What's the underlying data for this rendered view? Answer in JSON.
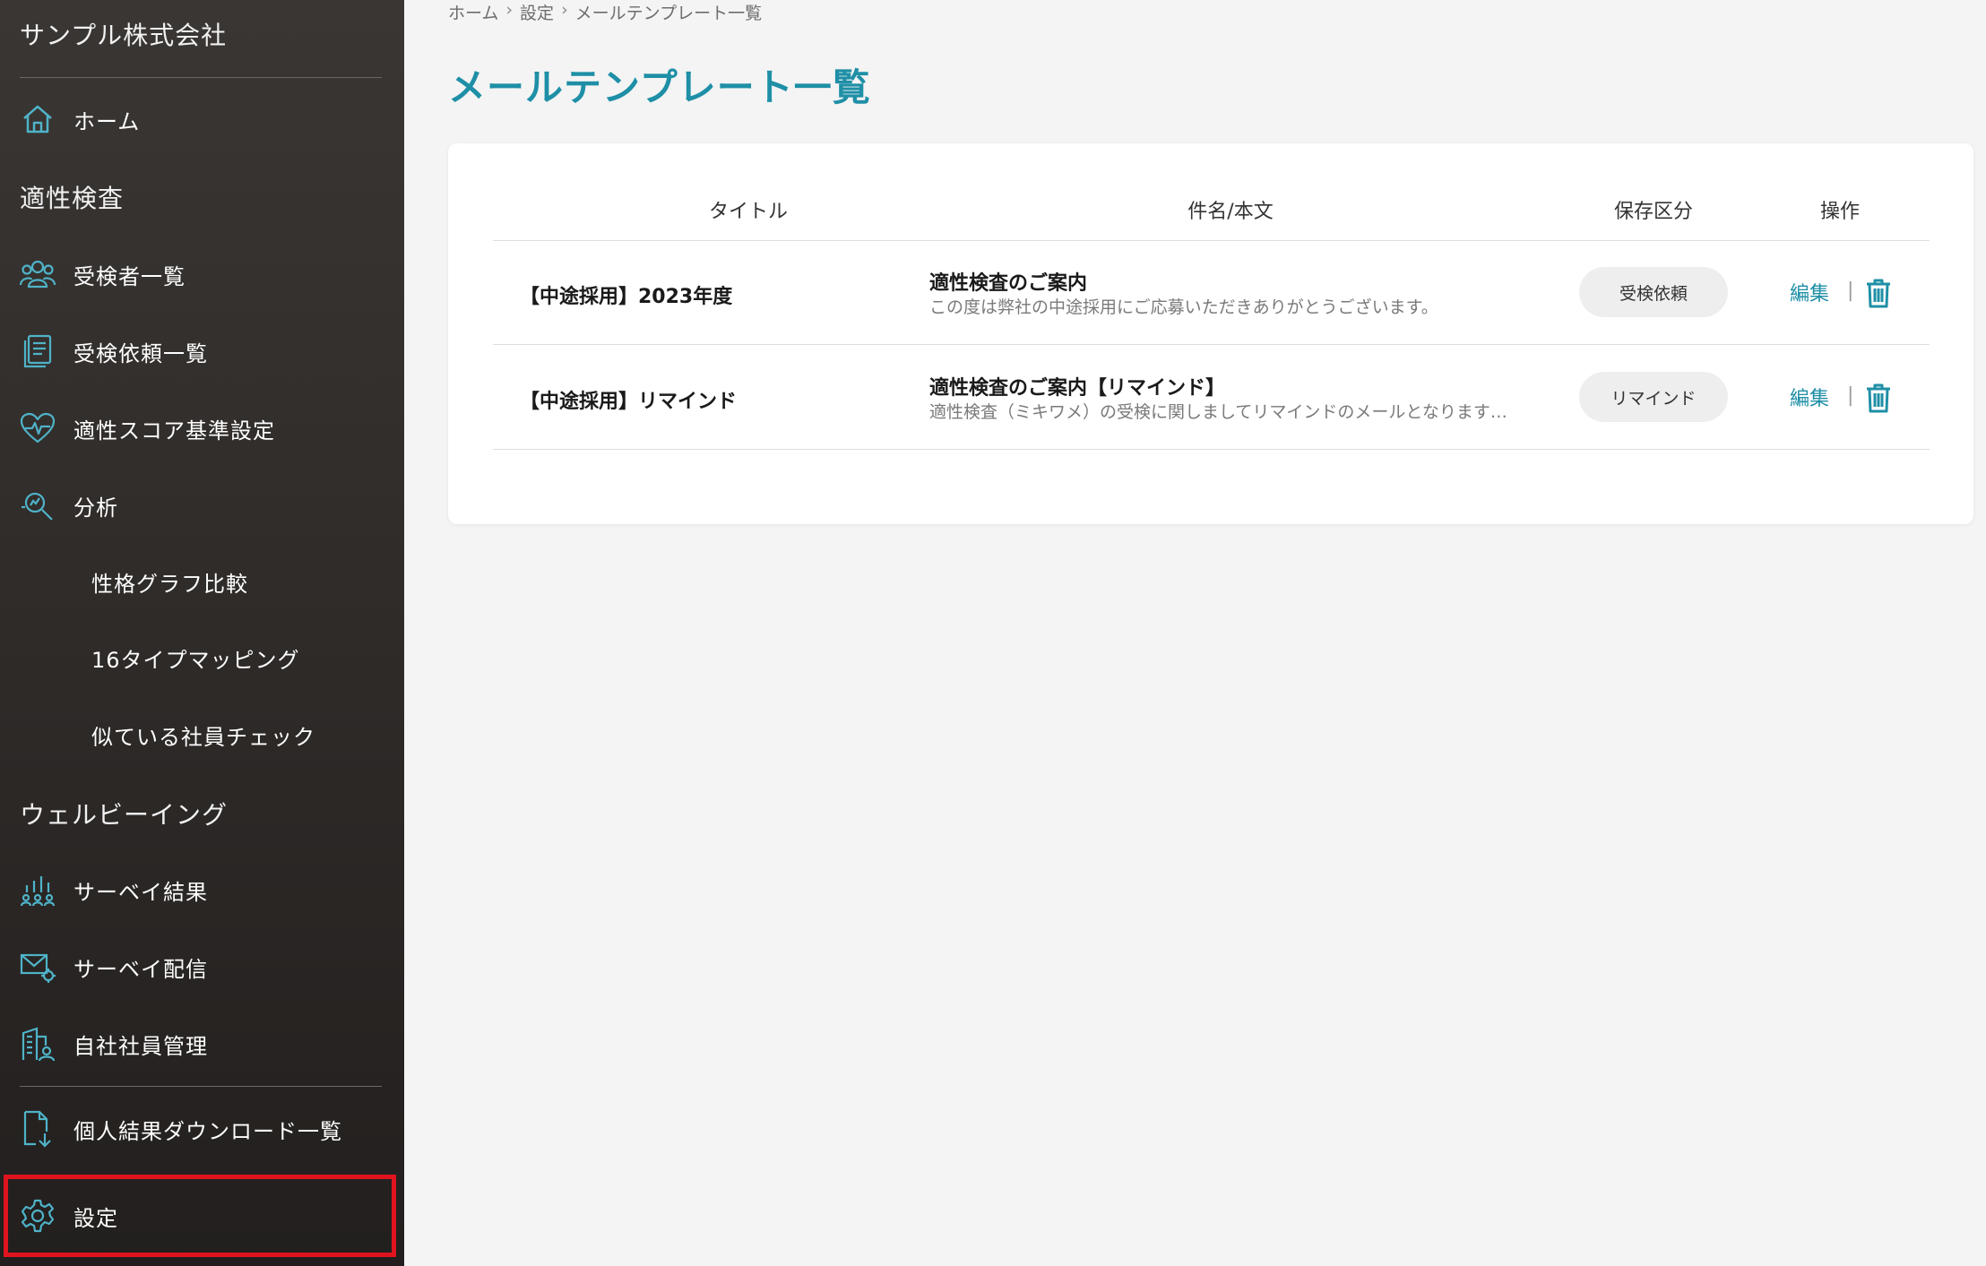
{
  "sidebar": {
    "company": "サンプル株式会社",
    "home": "ホーム",
    "section_aptitude": "適性検査",
    "examinees": "受検者一覧",
    "requests": "受検依頼一覧",
    "score_settings": "適性スコア基準設定",
    "analysis": "分析",
    "personality_graph": "性格グラフ比較",
    "type_mapping": "16タイプマッピング",
    "similar_check": "似ている社員チェック",
    "section_wellbeing": "ウェルビーイング",
    "survey_results": "サーベイ結果",
    "survey_delivery": "サーベイ配信",
    "employee_mgmt": "自社社員管理",
    "download_list": "個人結果ダウンロード一覧",
    "settings": "設定"
  },
  "breadcrumb": {
    "home": "ホーム",
    "settings": "設定",
    "current": "メールテンプレート一覧",
    "sep": "›"
  },
  "page": {
    "title": "メールテンプレート一覧"
  },
  "table": {
    "headers": {
      "title": "タイトル",
      "subject": "件名/本文",
      "category": "保存区分",
      "actions": "操作"
    },
    "rows": [
      {
        "title": "【中途採用】2023年度",
        "subject": "適性検査のご案内",
        "body": "この度は弊社の中途採用にご応募いただきありがとうございます。",
        "category": "受検依頼",
        "edit": "編集"
      },
      {
        "title": "【中途採用】リマインド",
        "subject": "適性検査のご案内【リマインド】",
        "body": "適性検査（ミキワメ）の受検に関しましてリマインドのメールとなります…",
        "category": "リマインド",
        "edit": "編集"
      }
    ],
    "separator": "|"
  },
  "colors": {
    "accent": "#1e8fa6",
    "sidebar_bg": "#2f2b29",
    "highlight": "#e0141e"
  }
}
